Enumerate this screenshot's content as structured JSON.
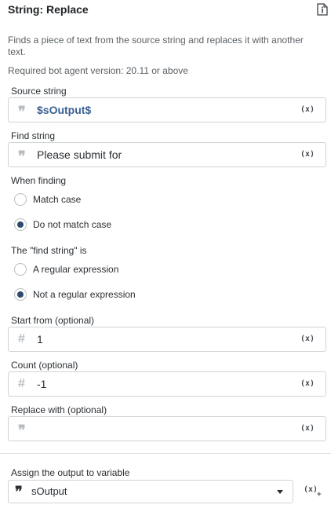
{
  "header": {
    "title": "String: Replace",
    "info_icon": "info-icon"
  },
  "description": "Finds a piece of text from the source string and replaces it with another text.",
  "requirement": "Required bot agent version: 20.11 or above",
  "source_string": {
    "label": "Source string",
    "prefix_icon": "quote-icon",
    "value": "$sOutput$",
    "var_button": "(x)"
  },
  "find_string": {
    "label": "Find string",
    "prefix_icon": "quote-icon",
    "value": "Please submit for",
    "var_button": "(x)"
  },
  "when_finding": {
    "label": "When finding",
    "options": [
      {
        "label": "Match case",
        "checked": false
      },
      {
        "label": "Do not match case",
        "checked": true
      }
    ]
  },
  "find_string_is": {
    "label": "The \"find string\" is",
    "options": [
      {
        "label": "A regular expression",
        "checked": false
      },
      {
        "label": "Not a regular expression",
        "checked": true
      }
    ]
  },
  "start_from": {
    "label": "Start from (optional)",
    "prefix": "#",
    "value": "1",
    "var_button": "(x)"
  },
  "count": {
    "label": "Count (optional)",
    "prefix": "#",
    "value": "-1",
    "var_button": "(x)"
  },
  "replace_with": {
    "label": "Replace with (optional)",
    "prefix_icon": "quote-icon",
    "value": "",
    "var_button": "(x)"
  },
  "assign_output": {
    "label": "Assign the output to variable",
    "prefix_icon": "quote-icon",
    "value": "sOutput",
    "add_var_button": "(x)",
    "add_var_sub": "+"
  },
  "colors": {
    "accent": "#2d4a6e",
    "variable_text": "#3a6090",
    "border": "#cfd4d8"
  }
}
